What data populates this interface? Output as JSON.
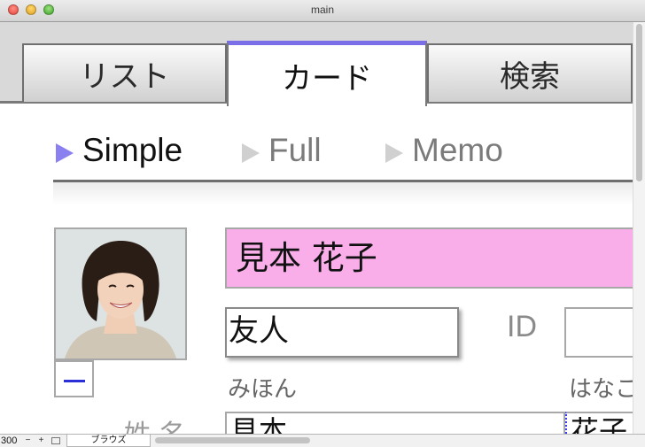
{
  "window": {
    "title": "main"
  },
  "tabs": [
    {
      "label": "リスト",
      "active": false
    },
    {
      "label": "カード",
      "active": true
    },
    {
      "label": "検索",
      "active": false
    }
  ],
  "subnav": [
    {
      "label": "Simple",
      "active": true
    },
    {
      "label": "Full",
      "active": false
    },
    {
      "label": "Memo",
      "active": false
    }
  ],
  "record": {
    "full_name": "見本 花子",
    "relationship": "友人",
    "id_label": "ID",
    "id_value": "",
    "kana_last": "みほん",
    "kana_first": "はなこ",
    "name_label": "姓 名",
    "last_name": "見本",
    "first_name": "花子",
    "photo_remove_icon": "minus-icon"
  },
  "status": {
    "zoom": "300",
    "mode": "ブラウズ"
  },
  "colors": {
    "tab_accent": "#7b6fe8",
    "name_field_bg": "#f9aee9",
    "subnav_active": "#8a80f0"
  }
}
